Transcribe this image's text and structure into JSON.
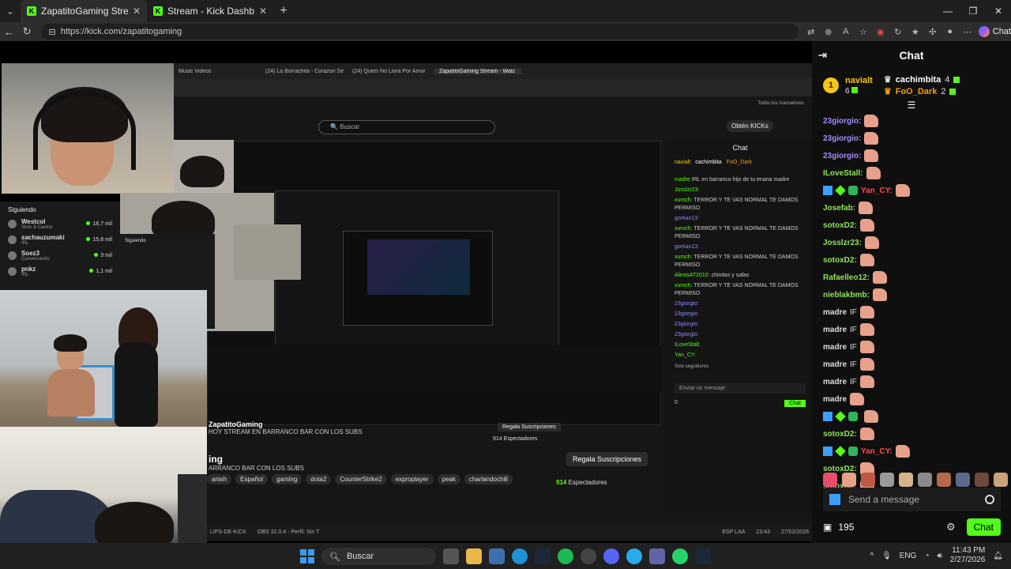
{
  "browser": {
    "tabs": [
      {
        "label": "ZapatitoGaming Stream - Watch L",
        "active": true
      },
      {
        "label": "Stream - Kick Dashboard",
        "active": false
      }
    ],
    "url": "https://kick.com/zapatitogaming",
    "chat_button": "Chat"
  },
  "inner": {
    "tabs": [
      "Music Videos",
      "(24) La Borrachita - Corazon Se",
      "(24) Quien No Llora Por Amor",
      "ZapatitoGaming Stream - Watc"
    ],
    "search_placeholder": "Buscar",
    "obtain_kicks": "Obtén KICKs",
    "chat_title": "Chat",
    "bookmarks": "Todos los marcadores",
    "chat_lines": [
      {
        "user": "madre",
        "text": "IRL en barranco hijo de tu enana madre"
      },
      {
        "user": "Josslzr23:",
        "text": ""
      },
      {
        "user": "xumch:",
        "text": "TERROR Y TE VAS NORMAL TE DAMOS PERMISO"
      },
      {
        "user": "gortian13:",
        "text": ""
      },
      {
        "user": "xumch:",
        "text": "TERROR Y TE VAS NORMAL TE DAMOS PERMISO"
      },
      {
        "user": "gortian13:",
        "text": ""
      },
      {
        "user": "xumch:",
        "text": "TERROR Y TE VAS NORMAL TE DAMOS PERMISO"
      },
      {
        "user": "AlexisAT2010:",
        "text": "chinitas y safas"
      },
      {
        "user": "xumch:",
        "text": "TERROR Y TE VAS NORMAL TE DAMOS PERMISO"
      },
      {
        "user": "23giorgio:",
        "text": ""
      },
      {
        "user": "23giorgio:",
        "text": ""
      },
      {
        "user": "23giorgio:",
        "text": ""
      },
      {
        "user": "23giorgio:",
        "text": ""
      },
      {
        "user": "ILoveStall:",
        "text": ""
      },
      {
        "user": "Yan_CY:",
        "text": ""
      }
    ],
    "followers_only": "Solo seguidores",
    "send_placeholder": "Enviar un mensaje",
    "inner_count": "0",
    "inner_chat_btn": "Chat",
    "stream_title": "ZapatitoGaming",
    "stream_sub": "HOY STREAM EN BARRANCO BAR CON LOS SUBS",
    "big_title": "ing",
    "big_sub": "ARRANCO BAR CON LOS SUBS",
    "tags": [
      "anish",
      "Español",
      "gaming",
      "dota2",
      "CounterStrike2",
      "exproplayer",
      "peak",
      "charlandochill"
    ],
    "regala": "Regala Suscripciones",
    "viewers_count": "914",
    "viewers_label": "Espectadores",
    "regala_small": "Regala Suscripciones",
    "viewers_small": "914 Espectadores",
    "taskbar_obs": "OBS 32.0.4 - Perfil: Sin T",
    "taskbar_clips": "LIPS-DE-KICK",
    "inner_lang": "ESP LAA",
    "inner_time": "23:43",
    "inner_date": "27/02/2026"
  },
  "follow_panel": {
    "title": "Siguiendo",
    "items": [
      {
        "name": "Westcol",
        "sub": "Slots & Casino",
        "count": "16,7 mil"
      },
      {
        "name": "sachauzumaki",
        "sub": "IRL",
        "count": "15,6 mil"
      },
      {
        "name": "Soez3",
        "sub": "Conversando",
        "count": "3 mil"
      },
      {
        "name": "pnkz",
        "sub": "IRL",
        "count": "1,1 mil"
      }
    ]
  },
  "chat": {
    "title": "Chat",
    "pinned": [
      {
        "rank": "1",
        "name": "navialt",
        "count": "6"
      },
      {
        "name": "cachimbita",
        "count": "4"
      },
      {
        "name": "FoO_Dark",
        "count": "2"
      }
    ],
    "messages": [
      {
        "user": "23giorgio:",
        "color": "#a78bfa",
        "text": ""
      },
      {
        "user": "23giorgio:",
        "color": "#a78bfa",
        "text": ""
      },
      {
        "user": "23giorgio:",
        "color": "#a78bfa",
        "text": ""
      },
      {
        "user": "ILoveStall:",
        "color": "#8ee35b",
        "text": ""
      },
      {
        "user": "Yan_CY:",
        "color": "#ff4d4d",
        "text": ""
      },
      {
        "user": "Josefab:",
        "color": "#8ee35b",
        "text": ""
      },
      {
        "user": "sotoxD2:",
        "color": "#8ee35b",
        "text": ""
      },
      {
        "user": "Josslzr23:",
        "color": "#8ee35b",
        "text": ""
      },
      {
        "user": "sotoxD2:",
        "color": "#8ee35b",
        "text": ""
      },
      {
        "user": "Rafaelleo12:",
        "color": "#8ee35b",
        "text": ""
      },
      {
        "user": "nieblakbmb:",
        "color": "#8ee35b",
        "text": ""
      },
      {
        "user": "madre",
        "color": "#dddddd",
        "text": "IF"
      },
      {
        "user": "madre",
        "color": "#dddddd",
        "text": "IF"
      },
      {
        "user": "madre",
        "color": "#dddddd",
        "text": "IF"
      },
      {
        "user": "madre",
        "color": "#dddddd",
        "text": "IF"
      },
      {
        "user": "madre",
        "color": "#dddddd",
        "text": "IF"
      },
      {
        "user": "madre",
        "color": "#dddddd",
        "text": ""
      },
      {
        "user": "",
        "color": "#ff4d4d",
        "text": ""
      },
      {
        "user": "sotoxD2:",
        "color": "#8ee35b",
        "text": ""
      },
      {
        "user": "Yan_CY:",
        "color": "#ff4d4d",
        "text": ""
      },
      {
        "user": "sotoxD2:",
        "color": "#8ee35b",
        "text": ""
      },
      {
        "user": "sotoxD2:",
        "color": "#8ee35b",
        "text": ""
      }
    ],
    "send_placeholder": "Send a message",
    "points": "195",
    "chat_button": "Chat"
  },
  "taskbar": {
    "search_placeholder": "Buscar",
    "lang": "ENG",
    "time": "11:43 PM",
    "date": "2/27/2026"
  },
  "colors": {
    "kick_green": "#53fc18",
    "gold": "#f5c518"
  }
}
